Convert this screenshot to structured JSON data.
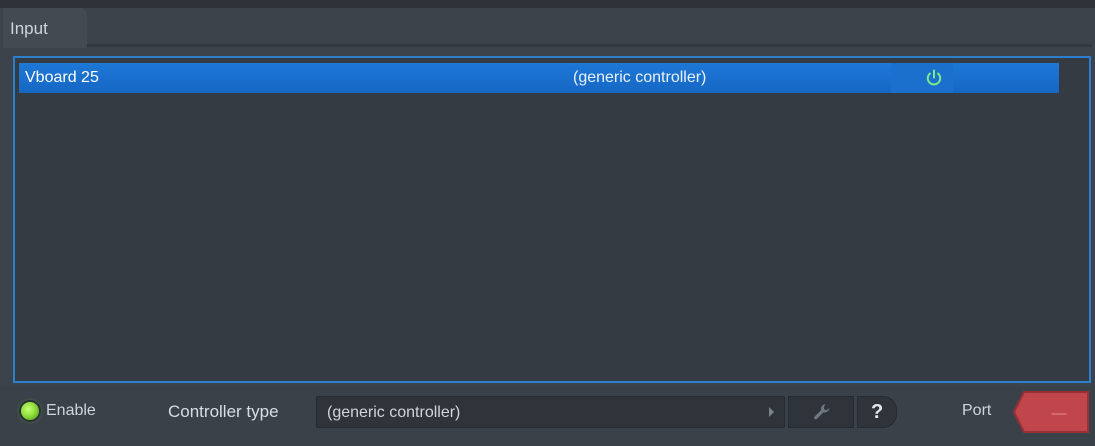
{
  "tab": {
    "label": "Input"
  },
  "devices": [
    {
      "name": "Vboard 25",
      "controller": "(generic controller)",
      "power_icon": "power-icon",
      "selected": true
    }
  ],
  "bottom": {
    "enable_label": "Enable",
    "enable_state": "on",
    "controller_type_label": "Controller type",
    "controller_type_value": "(generic controller)",
    "help_label": "?",
    "port_label": "Port",
    "port_value": "—"
  },
  "colors": {
    "panel_bg": "#3c434b",
    "selection_blue": "#1e78d6",
    "list_border": "#2c7fcc",
    "led_green": "#8fe03a",
    "port_red": "#c0464c",
    "power_icon_green": "#7bea8a"
  },
  "icons": [
    "power-icon",
    "wrench-icon",
    "help-icon",
    "dropdown-arrow-icon",
    "enable-led-icon"
  ]
}
